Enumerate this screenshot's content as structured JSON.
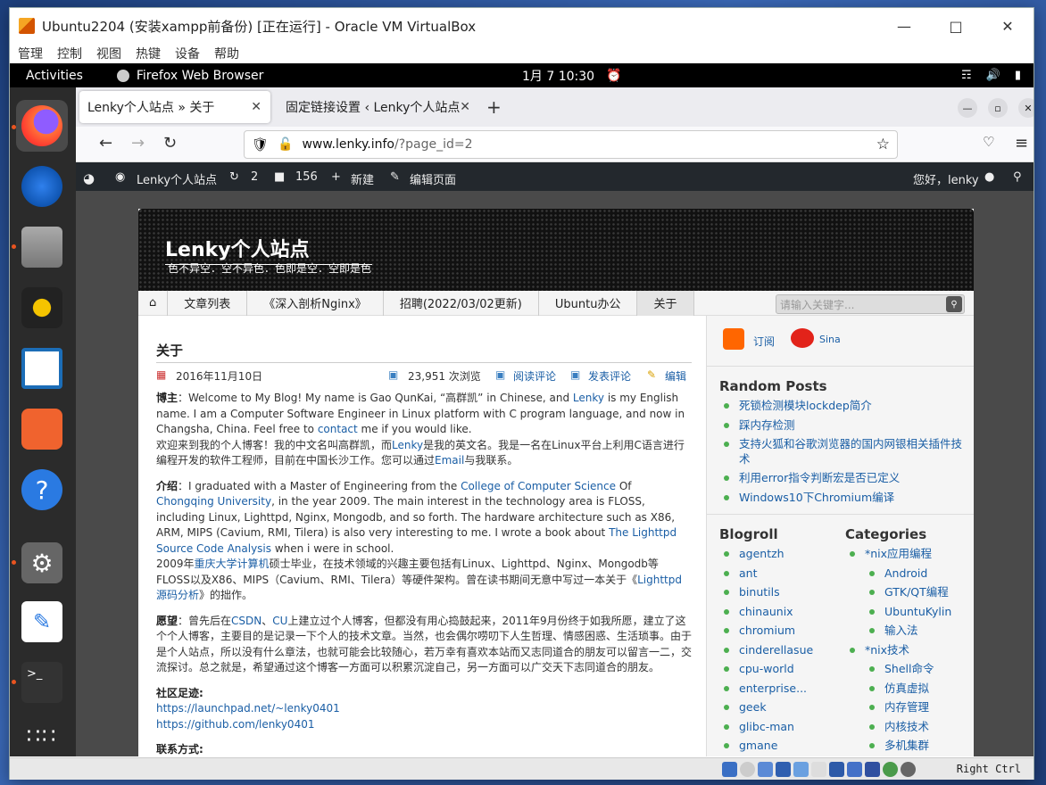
{
  "vm_window": {
    "title": "Ubuntu2204 (安装xampp前备份) [正在运行] - Oracle VM VirtualBox",
    "menu": [
      "管理",
      "控制",
      "视图",
      "热键",
      "设备",
      "帮助"
    ],
    "host_key": "Right Ctrl"
  },
  "guest_topbar": {
    "activities": "Activities",
    "app": "Firefox Web Browser",
    "datetime": "1月 7  10:30"
  },
  "dock": [
    "firefox-icon",
    "thunderbird-icon",
    "files-icon",
    "rhythmbox-icon",
    "libreoffice-writer-icon",
    "software-center-icon",
    "help-icon",
    "settings-icon",
    "text-editor-icon",
    "terminal-icon",
    "show-apps-icon"
  ],
  "browser": {
    "tabs": [
      {
        "label": "Lenky个人站点 » 关于",
        "active": true
      },
      {
        "label": "固定链接设置 ‹ Lenky个人站点",
        "active": false
      }
    ],
    "url_host": "www.lenky.info",
    "url_path": "/?page_id=2"
  },
  "wp_admin": {
    "site": "Lenky个人站点",
    "updates": "2",
    "comments": "156",
    "new": "新建",
    "edit": "编辑页面",
    "greeting": "您好，lenky"
  },
  "site": {
    "title": "Lenky个人站点",
    "tagline": "色不异空．空不异色．色即是空．空即是色",
    "breadcrumbs": [
      "文章列表",
      "《深入剖析Nginx》",
      "招聘(2022/03/02更新)",
      "Ubuntu办公",
      "关于"
    ],
    "search_placeholder": "请输入关键字..."
  },
  "post": {
    "title": "关于",
    "date": "2016年11月10日",
    "views": "23,951 次浏览",
    "read_comments": "阅读评论",
    "post_comment": "发表评论",
    "edit": "编辑",
    "p1_label": "博主",
    "p1_en_a": "：Welcome to My Blog! My name is Gao QunKai, “高群凯” in Chinese, and ",
    "p1_link1": "Lenky",
    "p1_en_b": " is my English name. I am a Computer Software Engineer in Linux platform with C program language, and now in Changsha, China. Feel free to ",
    "p1_link2": "contact",
    "p1_en_c": " me if you would like.",
    "p1_cn_a": "欢迎来到我的个人博客！我的中文名叫高群凯，而",
    "p1_cn_link": "Lenky",
    "p1_cn_b": "是我的英文名。我是一名在Linux平台上利用C语言进行编程开发的软件工程师，目前在中国长沙工作。您可以通过",
    "p1_cn_link2": "Email",
    "p1_cn_c": "与我联系。",
    "p2_label": "介绍",
    "p2_a": "：I graduated with a Master of Engineering from the ",
    "p2_link1": "College of Computer Science",
    "p2_b": " Of ",
    "p2_link2": "Chongqing University",
    "p2_c": ", in the year 2009. The main interest in the technology area is FLOSS, including Linux, Lighttpd, Nginx, Mongodb, and so forth. The hardware architecture such as X86, ARM, MIPS (Cavium, RMI, Tilera) is also very interesting to me. I wrote a book about ",
    "p2_link3": "The Lighttpd Source Code Analysis",
    "p2_d": " when i were in school.",
    "p2_cn_a": "2009年",
    "p2_cn_link": "重庆大学计算机",
    "p2_cn_b": "硕士毕业，在技术领域的兴趣主要包括有Linux、Lighttpd、Nginx、Mongodb等FLOSS以及X86、MIPS（Cavium、RMI、Tilera）等硬件架构。曾在读书期间无意中写过一本关于《",
    "p2_cn_link2": "Lighttpd源码分析",
    "p2_cn_c": "》的拙作。",
    "p3_label": "愿望",
    "p3_a": "：曾先后在",
    "p3_link1": "CSDN",
    "p3_sep": "、",
    "p3_link2": "CU",
    "p3_b": "上建立过个人博客，但都没有用心捣鼓起来，2011年9月份终于如我所愿，建立了这个个人博客，主要目的是记录一下个人的技术文章。当然，也会偶尔唠叨下人生哲理、情感困惑、生活琐事。由于是个人站点，所以没有什么章法，也就可能会比较随心，若万幸有喜欢本站而又志同道合的朋友可以留言一二，交流探讨。总之就是，希望通过这个博客一方面可以积累沉淀自己，另一方面可以广交天下志同道合的朋友。",
    "p4_label": "社区足迹:",
    "p4_link1": "https://launchpad.net/~lenky0401",
    "p4_link2": "https://github.com/lenky0401",
    "p5_label": "联系方式:"
  },
  "sidebar": {
    "subscribe": "订阅",
    "sina": "Sina",
    "random_title": "Random Posts",
    "random": [
      "死锁检测模块lockdep简介",
      "踩内存检测",
      "支持火狐和谷歌浏览器的国内网银相关插件技术",
      "利用error指令判断宏是否已定义",
      "Windows10下Chromium编译"
    ],
    "blogroll_title": "Blogroll",
    "blogroll": [
      "agentzh",
      "ant",
      "binutils",
      "chinaunix",
      "chromium",
      "cinderellasue",
      "cpu-world",
      "enterprise...",
      "geek",
      "glibc-man",
      "gmane"
    ],
    "categories_title": "Categories",
    "categories": [
      {
        "label": "*nix应用编程",
        "sub": false
      },
      {
        "label": "Android",
        "sub": true
      },
      {
        "label": "GTK/QT编程",
        "sub": true
      },
      {
        "label": "UbuntuKylin",
        "sub": true
      },
      {
        "label": "输入法",
        "sub": true
      },
      {
        "label": "*nix技术",
        "sub": false
      },
      {
        "label": "Shell命令",
        "sub": true
      },
      {
        "label": "仿真虚拟",
        "sub": true
      },
      {
        "label": "内存管理",
        "sub": true
      },
      {
        "label": "内核技术",
        "sub": true
      },
      {
        "label": "多机集群",
        "sub": true
      }
    ]
  },
  "colors": {
    "accent": "#e95420",
    "link": "#1a5ea5",
    "wpbar": "#23282d"
  }
}
